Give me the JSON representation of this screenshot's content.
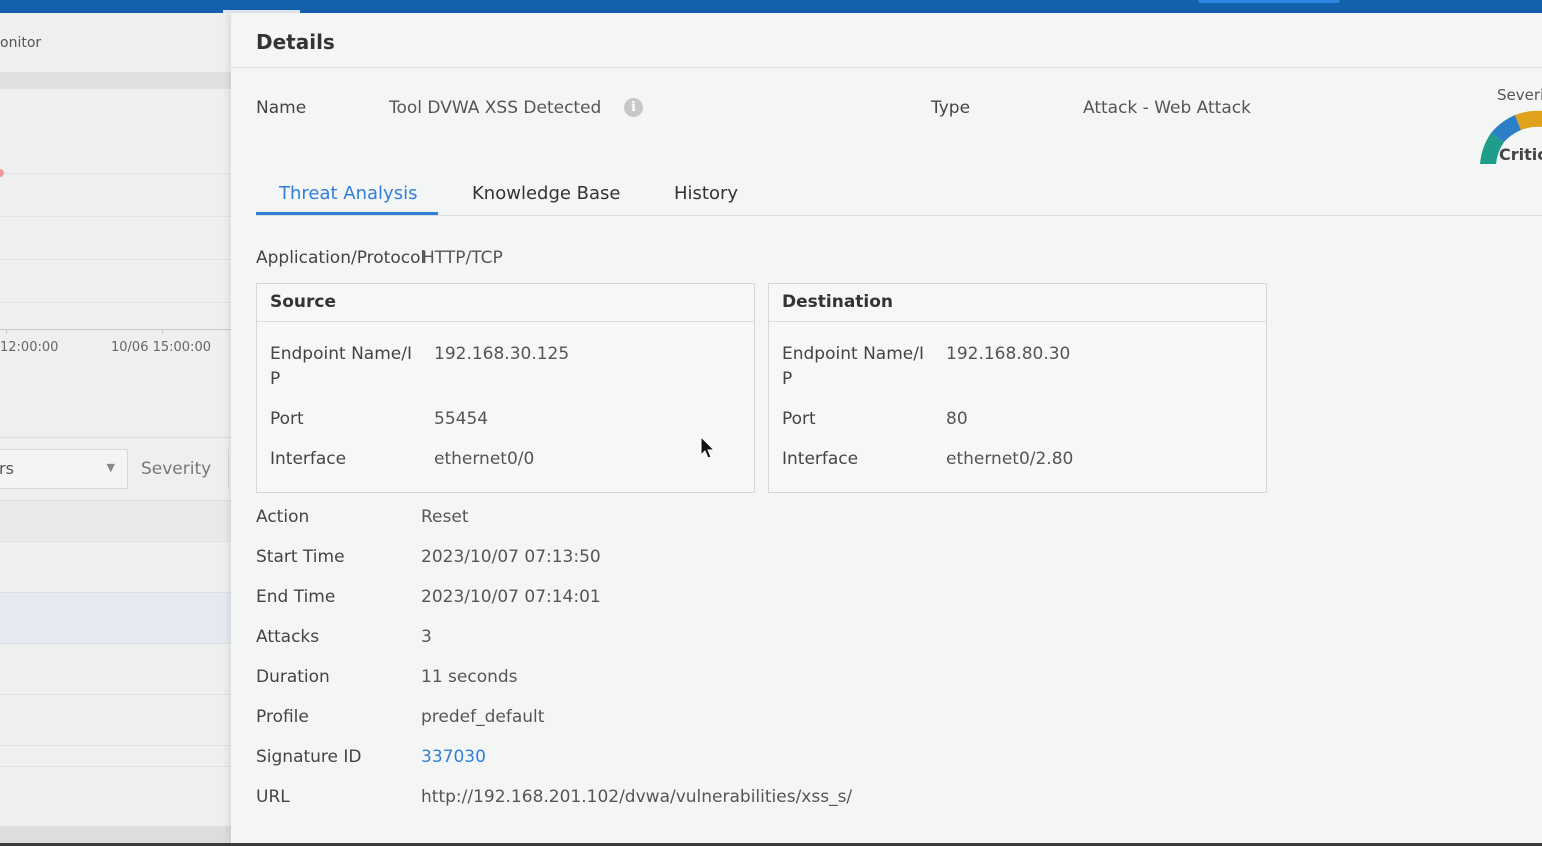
{
  "background": {
    "breadcrumb": "onitor",
    "chart_x_labels": [
      "12:00:00",
      "10/06 15:00:00"
    ],
    "filter_text": "rs",
    "filter_column": "Severity"
  },
  "details": {
    "title": "Details",
    "name_label": "Name",
    "name_value": "Tool DVWA XSS Detected",
    "type_label": "Type",
    "type_value": "Attack - Web Attack",
    "severity_label": "Severi",
    "severity_value": "Critic",
    "tabs": [
      {
        "label": "Threat Analysis",
        "active": true
      },
      {
        "label": "Knowledge Base",
        "active": false
      },
      {
        "label": "History",
        "active": false
      }
    ],
    "app_protocol_label": "Application/Protocol",
    "app_protocol_value": "HTTP/TCP",
    "source": {
      "title": "Source",
      "endpoint_label": "Endpoint Name/I P",
      "endpoint_value": "192.168.30.125",
      "port_label": "Port",
      "port_value": "55454",
      "interface_label": "Interface",
      "interface_value": "ethernet0/0"
    },
    "destination": {
      "title": "Destination",
      "endpoint_label": "Endpoint Name/I P",
      "endpoint_value": "192.168.80.30",
      "port_label": "Port",
      "port_value": "80",
      "interface_label": "Interface",
      "interface_value": "ethernet0/2.80"
    },
    "fields": {
      "action_label": "Action",
      "action_value": "Reset",
      "start_label": "Start Time",
      "start_value": "2023/10/07 07:13:50",
      "end_label": "End Time",
      "end_value": "2023/10/07 07:14:01",
      "attacks_label": "Attacks",
      "attacks_value": "3",
      "duration_label": "Duration",
      "duration_value": "11 seconds",
      "profile_label": "Profile",
      "profile_value": "predef_default",
      "sigid_label": "Signature ID",
      "sigid_value": "337030",
      "url_label": "URL",
      "url_value": "http://192.168.201.102/dvwa/vulnerabilities/xss_s/"
    }
  },
  "colors": {
    "topbar": "#1360ac",
    "accent": "#2f7fd8"
  },
  "icons": {
    "info": "info-icon",
    "gauge": "severity-gauge-icon",
    "cursor": "mouse-cursor-icon"
  }
}
